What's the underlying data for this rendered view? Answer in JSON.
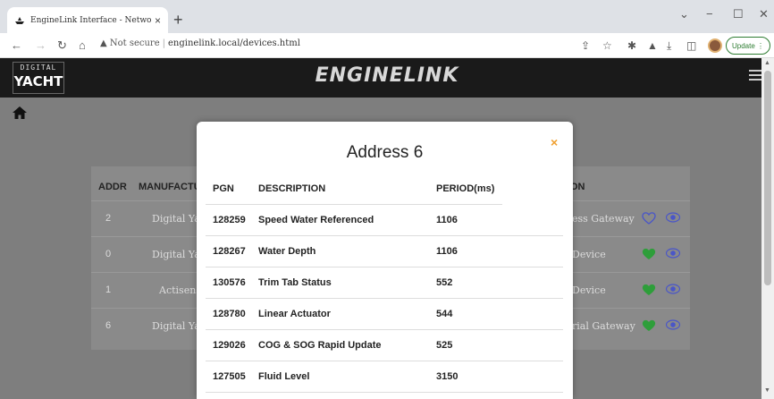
{
  "browser": {
    "tab_title": "EngineLink Interface - Network",
    "tab_close": "×",
    "new_tab": "+",
    "url_security": "Not secure",
    "url": "enginelink.local/devices.html",
    "update_label": "Update"
  },
  "header": {
    "logo_line1": "DIGITAL",
    "logo_line2": "YACHT",
    "brand": "ENGINELINK"
  },
  "table": {
    "headers": {
      "addr": "ADDR",
      "manufacturer": "MANUFACTU",
      "function": "ON"
    },
    "rows": [
      {
        "addr": "2",
        "manufacturer": "Digital Yac",
        "function": "ess Gateway",
        "favorite": false
      },
      {
        "addr": "0",
        "manufacturer": "Digital Yac",
        "function": "Device",
        "favorite": true
      },
      {
        "addr": "1",
        "manufacturer": "Actisens",
        "function": "Device",
        "favorite": true
      },
      {
        "addr": "6",
        "manufacturer": "Digital Yar",
        "function": "rial Gateway",
        "favorite": true
      }
    ]
  },
  "colors": {
    "heart_green": "#2e9e3a",
    "heart_outline": "#4a56c8",
    "eye": "#4a56c8",
    "close_x": "#f0a030"
  },
  "modal": {
    "title": "Address 6",
    "close": "×",
    "headers": {
      "pgn": "PGN",
      "description": "DESCRIPTION",
      "period": "PERIOD(ms)"
    },
    "rows": [
      {
        "pgn": "128259",
        "description": "Speed Water Referenced",
        "period": "1106"
      },
      {
        "pgn": "128267",
        "description": "Water Depth",
        "period": "1106"
      },
      {
        "pgn": "130576",
        "description": "Trim Tab Status",
        "period": "552"
      },
      {
        "pgn": "128780",
        "description": "Linear Actuator",
        "period": "544"
      },
      {
        "pgn": "129026",
        "description": "COG & SOG Rapid Update",
        "period": "525"
      },
      {
        "pgn": "127505",
        "description": "Fluid Level",
        "period": "3150"
      }
    ]
  }
}
